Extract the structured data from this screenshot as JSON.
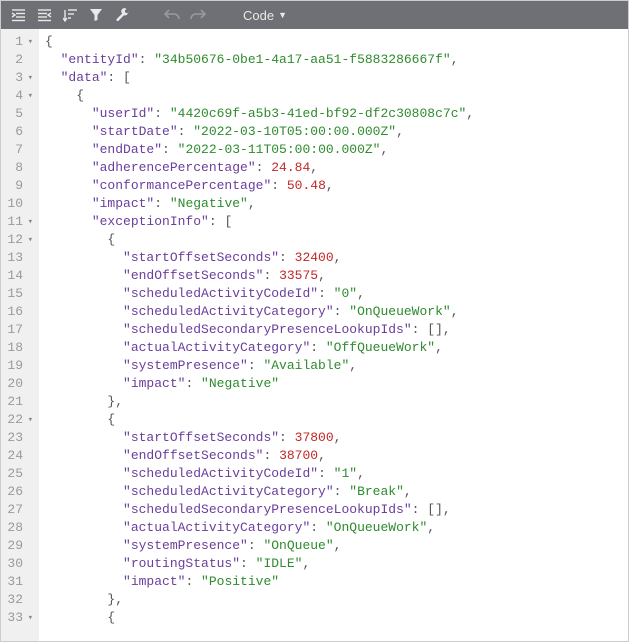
{
  "toolbar": {
    "mode_label": "Code"
  },
  "lines": [
    {
      "no": "1",
      "fold": true,
      "indent": 0,
      "tokens": [
        {
          "t": "{",
          "c": "punct"
        }
      ]
    },
    {
      "no": "2",
      "fold": false,
      "indent": 1,
      "tokens": [
        {
          "t": "\"entityId\"",
          "c": "key"
        },
        {
          "t": ": ",
          "c": "punct"
        },
        {
          "t": "\"34b50676-0be1-4a17-aa51-f5883286667f\"",
          "c": "str"
        },
        {
          "t": ",",
          "c": "punct"
        }
      ]
    },
    {
      "no": "3",
      "fold": true,
      "indent": 1,
      "tokens": [
        {
          "t": "\"data\"",
          "c": "key"
        },
        {
          "t": ": [",
          "c": "punct"
        }
      ]
    },
    {
      "no": "4",
      "fold": true,
      "indent": 2,
      "tokens": [
        {
          "t": "{",
          "c": "punct"
        }
      ]
    },
    {
      "no": "5",
      "fold": false,
      "indent": 3,
      "tokens": [
        {
          "t": "\"userId\"",
          "c": "key"
        },
        {
          "t": ": ",
          "c": "punct"
        },
        {
          "t": "\"4420c69f-a5b3-41ed-bf92-df2c30808c7c\"",
          "c": "str"
        },
        {
          "t": ",",
          "c": "punct"
        }
      ]
    },
    {
      "no": "6",
      "fold": false,
      "indent": 3,
      "tokens": [
        {
          "t": "\"startDate\"",
          "c": "key"
        },
        {
          "t": ": ",
          "c": "punct"
        },
        {
          "t": "\"2022-03-10T05:00:00.000Z\"",
          "c": "str"
        },
        {
          "t": ",",
          "c": "punct"
        }
      ]
    },
    {
      "no": "7",
      "fold": false,
      "indent": 3,
      "tokens": [
        {
          "t": "\"endDate\"",
          "c": "key"
        },
        {
          "t": ": ",
          "c": "punct"
        },
        {
          "t": "\"2022-03-11T05:00:00.000Z\"",
          "c": "str"
        },
        {
          "t": ",",
          "c": "punct"
        }
      ]
    },
    {
      "no": "8",
      "fold": false,
      "indent": 3,
      "tokens": [
        {
          "t": "\"adherencePercentage\"",
          "c": "key"
        },
        {
          "t": ": ",
          "c": "punct"
        },
        {
          "t": "24.84",
          "c": "num"
        },
        {
          "t": ",",
          "c": "punct"
        }
      ]
    },
    {
      "no": "9",
      "fold": false,
      "indent": 3,
      "tokens": [
        {
          "t": "\"conformancePercentage\"",
          "c": "key"
        },
        {
          "t": ": ",
          "c": "punct"
        },
        {
          "t": "50.48",
          "c": "num"
        },
        {
          "t": ",",
          "c": "punct"
        }
      ]
    },
    {
      "no": "10",
      "fold": false,
      "indent": 3,
      "tokens": [
        {
          "t": "\"impact\"",
          "c": "key"
        },
        {
          "t": ": ",
          "c": "punct"
        },
        {
          "t": "\"Negative\"",
          "c": "str"
        },
        {
          "t": ",",
          "c": "punct"
        }
      ]
    },
    {
      "no": "11",
      "fold": true,
      "indent": 3,
      "tokens": [
        {
          "t": "\"exceptionInfo\"",
          "c": "key"
        },
        {
          "t": ": [",
          "c": "punct"
        }
      ]
    },
    {
      "no": "12",
      "fold": true,
      "indent": 4,
      "tokens": [
        {
          "t": "{",
          "c": "punct"
        }
      ]
    },
    {
      "no": "13",
      "fold": false,
      "indent": 5,
      "tokens": [
        {
          "t": "\"startOffsetSeconds\"",
          "c": "key"
        },
        {
          "t": ": ",
          "c": "punct"
        },
        {
          "t": "32400",
          "c": "num"
        },
        {
          "t": ",",
          "c": "punct"
        }
      ]
    },
    {
      "no": "14",
      "fold": false,
      "indent": 5,
      "tokens": [
        {
          "t": "\"endOffsetSeconds\"",
          "c": "key"
        },
        {
          "t": ": ",
          "c": "punct"
        },
        {
          "t": "33575",
          "c": "num"
        },
        {
          "t": ",",
          "c": "punct"
        }
      ]
    },
    {
      "no": "15",
      "fold": false,
      "indent": 5,
      "tokens": [
        {
          "t": "\"scheduledActivityCodeId\"",
          "c": "key"
        },
        {
          "t": ": ",
          "c": "punct"
        },
        {
          "t": "\"0\"",
          "c": "str"
        },
        {
          "t": ",",
          "c": "punct"
        }
      ]
    },
    {
      "no": "16",
      "fold": false,
      "indent": 5,
      "tokens": [
        {
          "t": "\"scheduledActivityCategory\"",
          "c": "key"
        },
        {
          "t": ": ",
          "c": "punct"
        },
        {
          "t": "\"OnQueueWork\"",
          "c": "str"
        },
        {
          "t": ",",
          "c": "punct"
        }
      ]
    },
    {
      "no": "17",
      "fold": false,
      "indent": 5,
      "tokens": [
        {
          "t": "\"scheduledSecondaryPresenceLookupIds\"",
          "c": "key"
        },
        {
          "t": ": [],",
          "c": "punct"
        }
      ]
    },
    {
      "no": "18",
      "fold": false,
      "indent": 5,
      "tokens": [
        {
          "t": "\"actualActivityCategory\"",
          "c": "key"
        },
        {
          "t": ": ",
          "c": "punct"
        },
        {
          "t": "\"OffQueueWork\"",
          "c": "str"
        },
        {
          "t": ",",
          "c": "punct"
        }
      ]
    },
    {
      "no": "19",
      "fold": false,
      "indent": 5,
      "tokens": [
        {
          "t": "\"systemPresence\"",
          "c": "key"
        },
        {
          "t": ": ",
          "c": "punct"
        },
        {
          "t": "\"Available\"",
          "c": "str"
        },
        {
          "t": ",",
          "c": "punct"
        }
      ]
    },
    {
      "no": "20",
      "fold": false,
      "indent": 5,
      "tokens": [
        {
          "t": "\"impact\"",
          "c": "key"
        },
        {
          "t": ": ",
          "c": "punct"
        },
        {
          "t": "\"Negative\"",
          "c": "str"
        }
      ]
    },
    {
      "no": "21",
      "fold": false,
      "indent": 4,
      "tokens": [
        {
          "t": "},",
          "c": "punct"
        }
      ]
    },
    {
      "no": "22",
      "fold": true,
      "indent": 4,
      "tokens": [
        {
          "t": "{",
          "c": "punct"
        }
      ]
    },
    {
      "no": "23",
      "fold": false,
      "indent": 5,
      "tokens": [
        {
          "t": "\"startOffsetSeconds\"",
          "c": "key"
        },
        {
          "t": ": ",
          "c": "punct"
        },
        {
          "t": "37800",
          "c": "num"
        },
        {
          "t": ",",
          "c": "punct"
        }
      ]
    },
    {
      "no": "24",
      "fold": false,
      "indent": 5,
      "tokens": [
        {
          "t": "\"endOffsetSeconds\"",
          "c": "key"
        },
        {
          "t": ": ",
          "c": "punct"
        },
        {
          "t": "38700",
          "c": "num"
        },
        {
          "t": ",",
          "c": "punct"
        }
      ]
    },
    {
      "no": "25",
      "fold": false,
      "indent": 5,
      "tokens": [
        {
          "t": "\"scheduledActivityCodeId\"",
          "c": "key"
        },
        {
          "t": ": ",
          "c": "punct"
        },
        {
          "t": "\"1\"",
          "c": "str"
        },
        {
          "t": ",",
          "c": "punct"
        }
      ]
    },
    {
      "no": "26",
      "fold": false,
      "indent": 5,
      "tokens": [
        {
          "t": "\"scheduledActivityCategory\"",
          "c": "key"
        },
        {
          "t": ": ",
          "c": "punct"
        },
        {
          "t": "\"Break\"",
          "c": "str"
        },
        {
          "t": ",",
          "c": "punct"
        }
      ]
    },
    {
      "no": "27",
      "fold": false,
      "indent": 5,
      "tokens": [
        {
          "t": "\"scheduledSecondaryPresenceLookupIds\"",
          "c": "key"
        },
        {
          "t": ": [],",
          "c": "punct"
        }
      ]
    },
    {
      "no": "28",
      "fold": false,
      "indent": 5,
      "tokens": [
        {
          "t": "\"actualActivityCategory\"",
          "c": "key"
        },
        {
          "t": ": ",
          "c": "punct"
        },
        {
          "t": "\"OnQueueWork\"",
          "c": "str"
        },
        {
          "t": ",",
          "c": "punct"
        }
      ]
    },
    {
      "no": "29",
      "fold": false,
      "indent": 5,
      "tokens": [
        {
          "t": "\"systemPresence\"",
          "c": "key"
        },
        {
          "t": ": ",
          "c": "punct"
        },
        {
          "t": "\"OnQueue\"",
          "c": "str"
        },
        {
          "t": ",",
          "c": "punct"
        }
      ]
    },
    {
      "no": "30",
      "fold": false,
      "indent": 5,
      "tokens": [
        {
          "t": "\"routingStatus\"",
          "c": "key"
        },
        {
          "t": ": ",
          "c": "punct"
        },
        {
          "t": "\"IDLE\"",
          "c": "str"
        },
        {
          "t": ",",
          "c": "punct"
        }
      ]
    },
    {
      "no": "31",
      "fold": false,
      "indent": 5,
      "tokens": [
        {
          "t": "\"impact\"",
          "c": "key"
        },
        {
          "t": ": ",
          "c": "punct"
        },
        {
          "t": "\"Positive\"",
          "c": "str"
        }
      ]
    },
    {
      "no": "32",
      "fold": false,
      "indent": 4,
      "tokens": [
        {
          "t": "},",
          "c": "punct"
        }
      ]
    },
    {
      "no": "33",
      "fold": true,
      "indent": 4,
      "tokens": [
        {
          "t": "{",
          "c": "punct"
        }
      ]
    }
  ]
}
